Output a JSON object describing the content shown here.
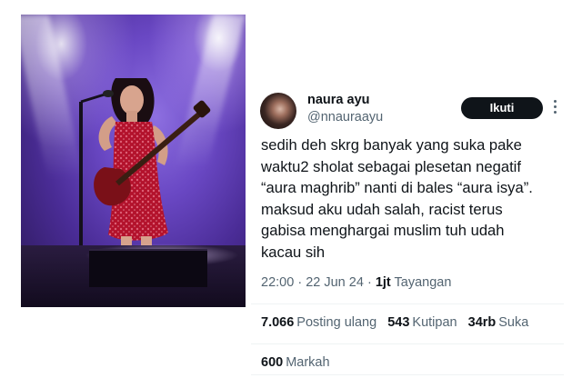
{
  "author": {
    "display_name": "naura ayu",
    "handle": "@nnauraayu"
  },
  "follow_button": {
    "label": "Ikuti"
  },
  "tweet": {
    "lines": [
      "sedih deh skrg banyak yang suka pake",
      "waktu2 sholat sebagai plesetan negatif",
      "“aura maghrib” nanti di bales “aura isya”.",
      "maksud aku udah salah, racist terus",
      "gabisa menghargai muslim tuh udah",
      "kacau sih"
    ]
  },
  "meta": {
    "time": "22:00",
    "separator": "·",
    "date": "22 Jun 24",
    "views_count": "1jt",
    "views_label": "Tayangan"
  },
  "stats": {
    "reposts": {
      "count": "7.066",
      "label": "Posting ulang"
    },
    "quotes": {
      "count": "543",
      "label": "Kutipan"
    },
    "likes": {
      "count": "34rb",
      "label": "Suka"
    },
    "bookmarks": {
      "count": "600",
      "label": "Markah"
    }
  },
  "icons": {
    "more": "more-vertical-icon"
  },
  "colors": {
    "text_primary": "#0f1419",
    "text_secondary": "#536471",
    "button_bg": "#0f1419",
    "divider": "#eff3f4"
  }
}
